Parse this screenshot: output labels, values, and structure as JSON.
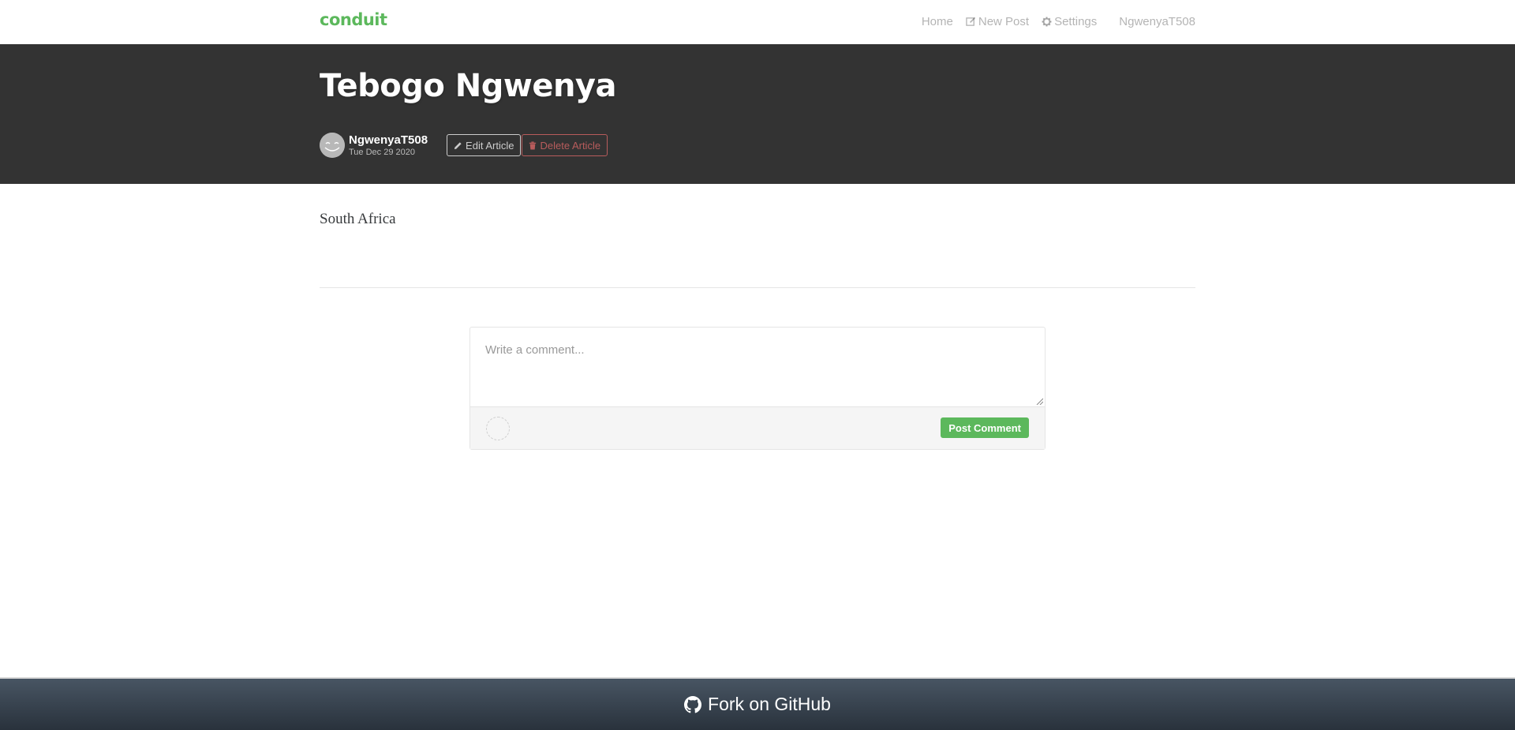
{
  "navbar": {
    "brand": "conduit",
    "items": [
      {
        "label": "Home",
        "icon": "none"
      },
      {
        "label": "New Post",
        "icon": "edit-icon"
      },
      {
        "label": "Settings",
        "icon": "gear-icon"
      },
      {
        "label": "NgwenyaT508",
        "icon": "none"
      }
    ]
  },
  "article": {
    "title": "Tebogo Ngwenya",
    "author": "NgwenyaT508",
    "date": "Tue Dec 29 2020",
    "body": "South Africa",
    "edit_label": "Edit Article",
    "delete_label": "Delete Article"
  },
  "comment_form": {
    "placeholder": "Write a comment...",
    "value": "",
    "post_label": "Post Comment"
  },
  "footer": {
    "label": "Fork on GitHub"
  },
  "colors": {
    "brand": "#5cb85c",
    "banner": "#333333",
    "danger": "#b85c5c"
  }
}
